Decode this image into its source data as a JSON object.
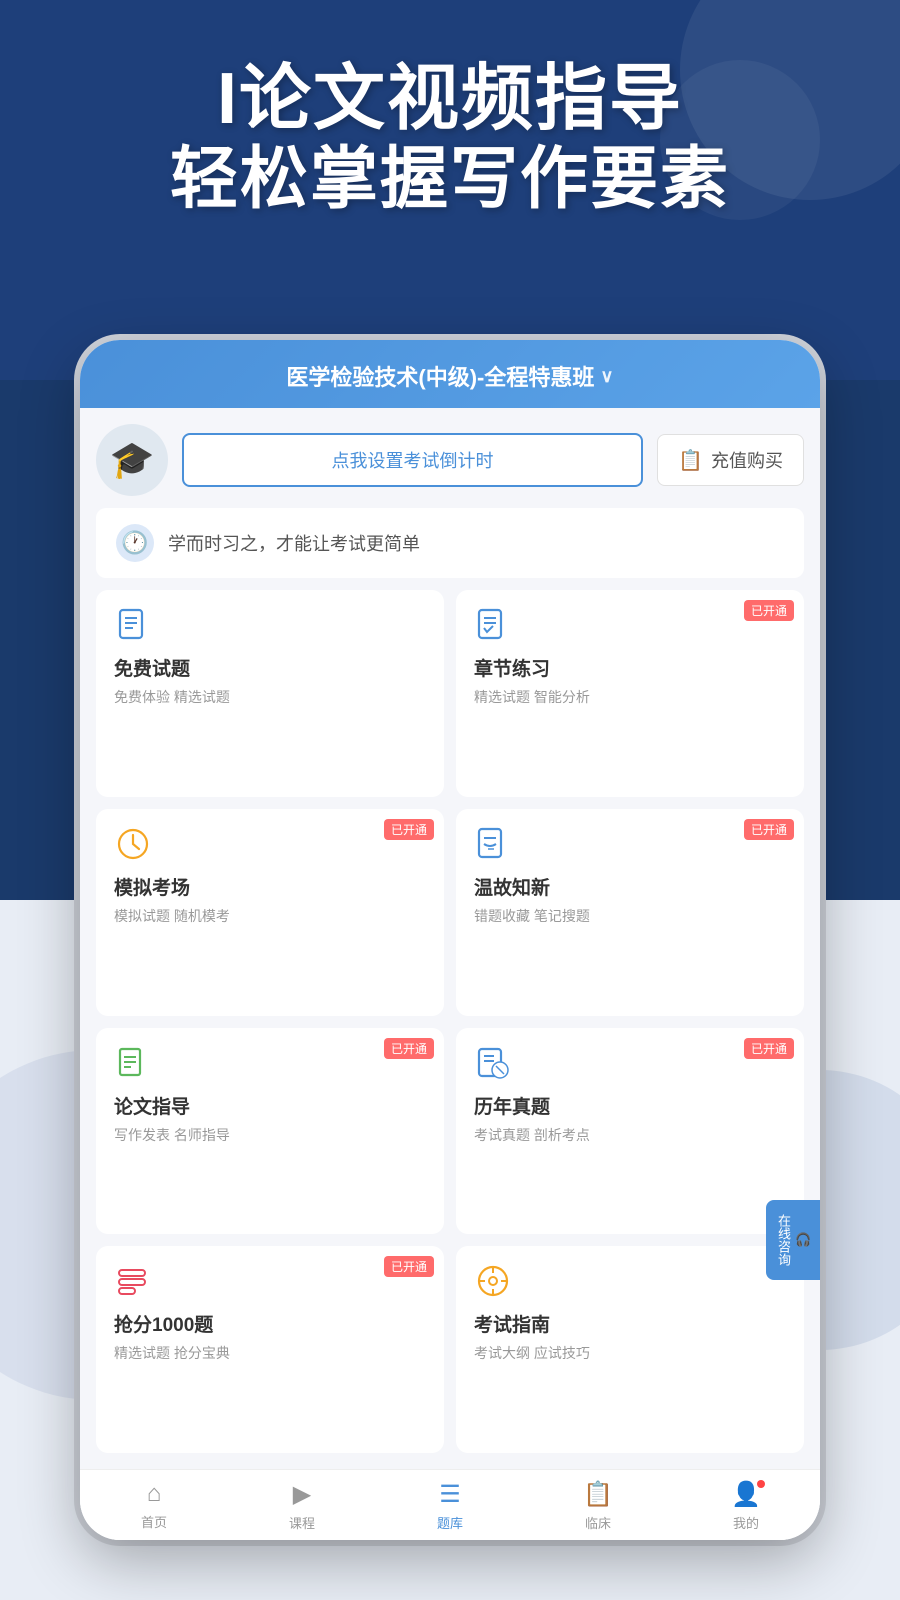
{
  "hero": {
    "line1": "I论文视频指导",
    "line2": "轻松掌握写作要素"
  },
  "app": {
    "topbar": {
      "title": "医学检验技术(中级)-全程特惠班",
      "chevron": "∨"
    },
    "profile": {
      "countdown_btn": "点我设置考试倒计时",
      "recharge_btn": "充值购买"
    },
    "motto": "学而时习之，才能让考试更简单",
    "grid": [
      {
        "id": "free-questions",
        "title": "免费试题",
        "sub": "免费体验 精选试题",
        "badge": "",
        "icon_color": "#4a90d9"
      },
      {
        "id": "chapter-practice",
        "title": "章节练习",
        "sub": "精选试题 智能分析",
        "badge": "已开通",
        "icon_color": "#4a90d9"
      },
      {
        "id": "mock-exam",
        "title": "模拟考场",
        "sub": "模拟试题 随机模考",
        "badge": "已开通",
        "icon_color": "#f5a623"
      },
      {
        "id": "review",
        "title": "温故知新",
        "sub": "错题收藏 笔记搜题",
        "badge": "已开通",
        "icon_color": "#4a90d9"
      },
      {
        "id": "paper-guide",
        "title": "论文指导",
        "sub": "写作发表 名师指导",
        "badge": "已开通",
        "icon_color": "#5cb85c"
      },
      {
        "id": "past-exams",
        "title": "历年真题",
        "sub": "考试真题 剖析考点",
        "badge": "已开通",
        "icon_color": "#4a90d9"
      },
      {
        "id": "rush-score",
        "title": "抢分1000题",
        "sub": "精选试题 抢分宝典",
        "badge": "已开通",
        "icon_color": "#e84a5f"
      },
      {
        "id": "exam-guide",
        "title": "考试指南",
        "sub": "考试大纲 应试技巧",
        "badge": "",
        "icon_color": "#f5a623"
      }
    ],
    "bottom_nav": [
      {
        "label": "首页",
        "icon": "🏠",
        "active": false
      },
      {
        "label": "课程",
        "icon": "▶",
        "active": false
      },
      {
        "label": "题库",
        "icon": "☰",
        "active": true
      },
      {
        "label": "临床",
        "icon": "📋",
        "active": false
      },
      {
        "label": "我的",
        "icon": "👤",
        "active": false,
        "has_dot": true
      }
    ],
    "online_consult": {
      "icon": "🎧",
      "text": "在线咨询"
    }
  }
}
